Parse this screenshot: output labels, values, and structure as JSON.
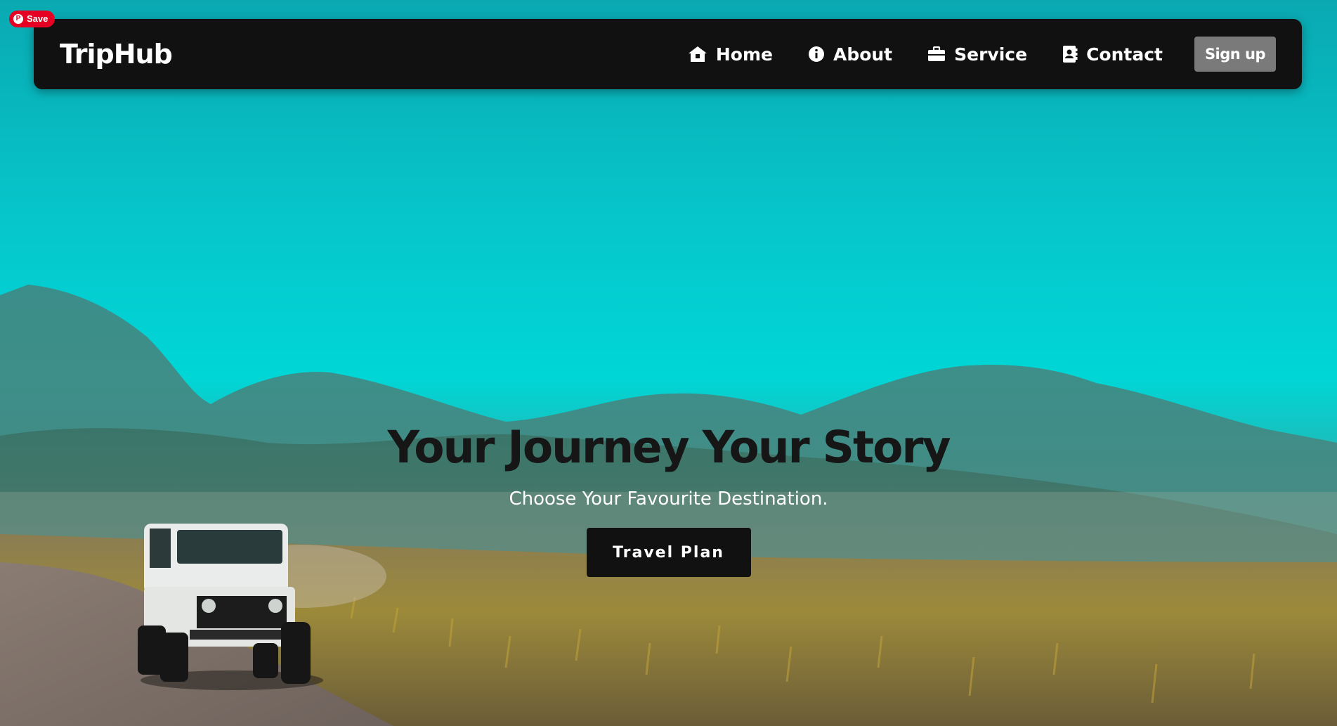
{
  "pinterest": {
    "save_label": "Save"
  },
  "navbar": {
    "brand": "TripHub",
    "links": [
      {
        "label": "Home",
        "icon": "home-icon"
      },
      {
        "label": "About",
        "icon": "info-icon"
      },
      {
        "label": "Service",
        "icon": "briefcase-icon"
      },
      {
        "label": "Contact",
        "icon": "contact-book-icon"
      }
    ],
    "signup_label": "Sign up"
  },
  "hero": {
    "headline": "Your Journey Your Story",
    "subtitle": "Choose Your Favourite Destination.",
    "cta_label": "Travel Plan"
  },
  "colors": {
    "navbar_bg": "#111111",
    "signup_bg": "#7a7a7a",
    "sky": "#00d6d6",
    "headline": "#161616"
  }
}
